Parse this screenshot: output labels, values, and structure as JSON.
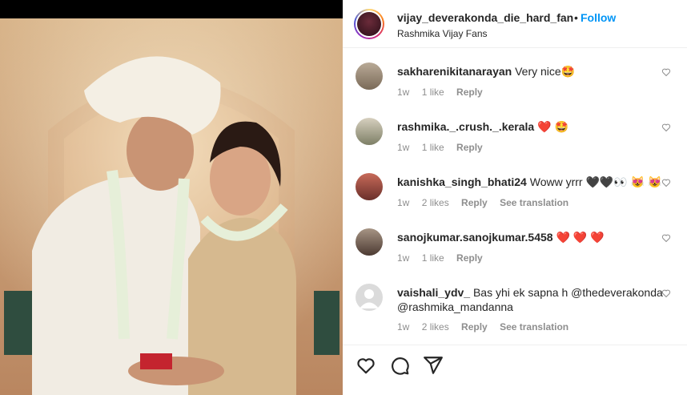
{
  "post": {
    "username": "vijay_deverakonda_die_hard_fan",
    "follow_label": "Follow",
    "subtitle": "Rashmika Vijay Fans"
  },
  "comments": [
    {
      "user": "sakharenikitanarayan",
      "text": "Very nice🤩",
      "time": "1w",
      "likes": "1 like",
      "reply": "Reply",
      "translation": ""
    },
    {
      "user": "rashmika._.crush._.kerala",
      "text": "❤️ 🤩",
      "time": "1w",
      "likes": "1 like",
      "reply": "Reply",
      "translation": ""
    },
    {
      "user": "kanishka_singh_bhati24",
      "text": "Woww yrrr 🖤🖤👀 😻 😻",
      "time": "1w",
      "likes": "2 likes",
      "reply": "Reply",
      "translation": "See translation"
    },
    {
      "user": "sanojkumar.sanojkumar.5458",
      "text": "❤️ ❤️ ❤️",
      "time": "1w",
      "likes": "1 like",
      "reply": "Reply",
      "translation": ""
    },
    {
      "user": "vaishali_ydv_",
      "text": "Bas yhi ek sapna h @thedeverakonda @rashmika_mandanna",
      "time": "1w",
      "likes": "2 likes",
      "reply": "Reply",
      "translation": "See translation"
    }
  ],
  "actions": {
    "like_icon": "heart-icon",
    "comment_icon": "comment-icon",
    "share_icon": "share-icon"
  },
  "colors": {
    "follow": "#0095f6",
    "meta": "#8e8e8e",
    "text": "#262626"
  }
}
